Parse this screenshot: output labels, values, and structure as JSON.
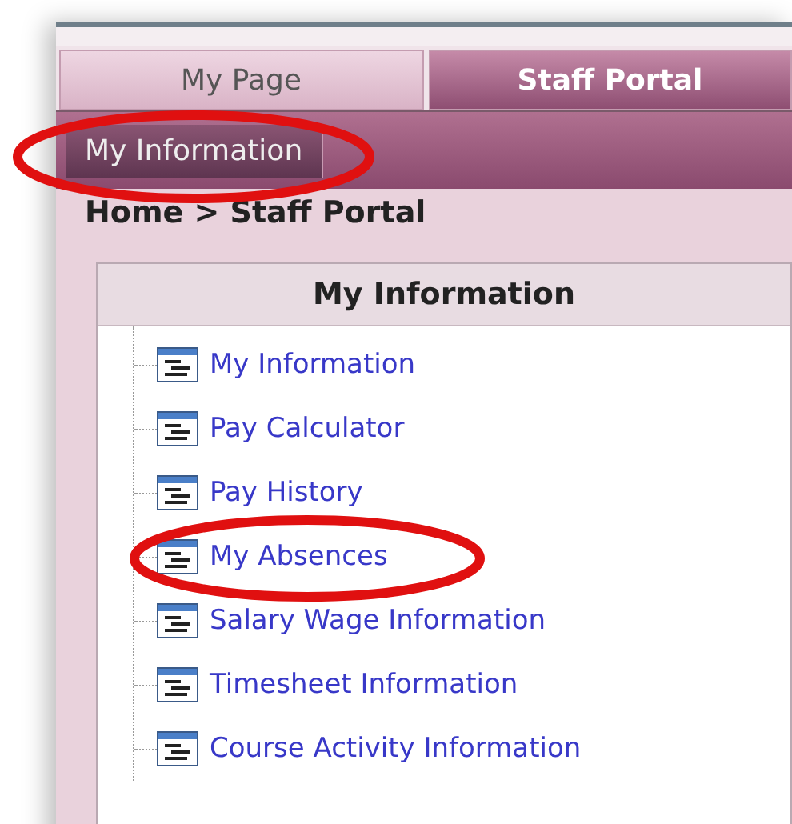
{
  "tabs": [
    {
      "label": "My Page",
      "selected": false
    },
    {
      "label": "Staff Portal",
      "selected": true
    }
  ],
  "subtabs": [
    {
      "label": "My Information",
      "selected": true
    }
  ],
  "breadcrumb": "Home > Staff Portal",
  "panel": {
    "title": "My Information",
    "items": [
      {
        "label": "My Information",
        "circled": false
      },
      {
        "label": "Pay Calculator",
        "circled": false
      },
      {
        "label": "Pay History",
        "circled": false
      },
      {
        "label": "My Absences",
        "circled": true
      },
      {
        "label": "Salary Wage Information",
        "circled": false
      },
      {
        "label": "Timesheet Information",
        "circled": false
      },
      {
        "label": "Course Activity Information",
        "circled": false
      }
    ]
  }
}
